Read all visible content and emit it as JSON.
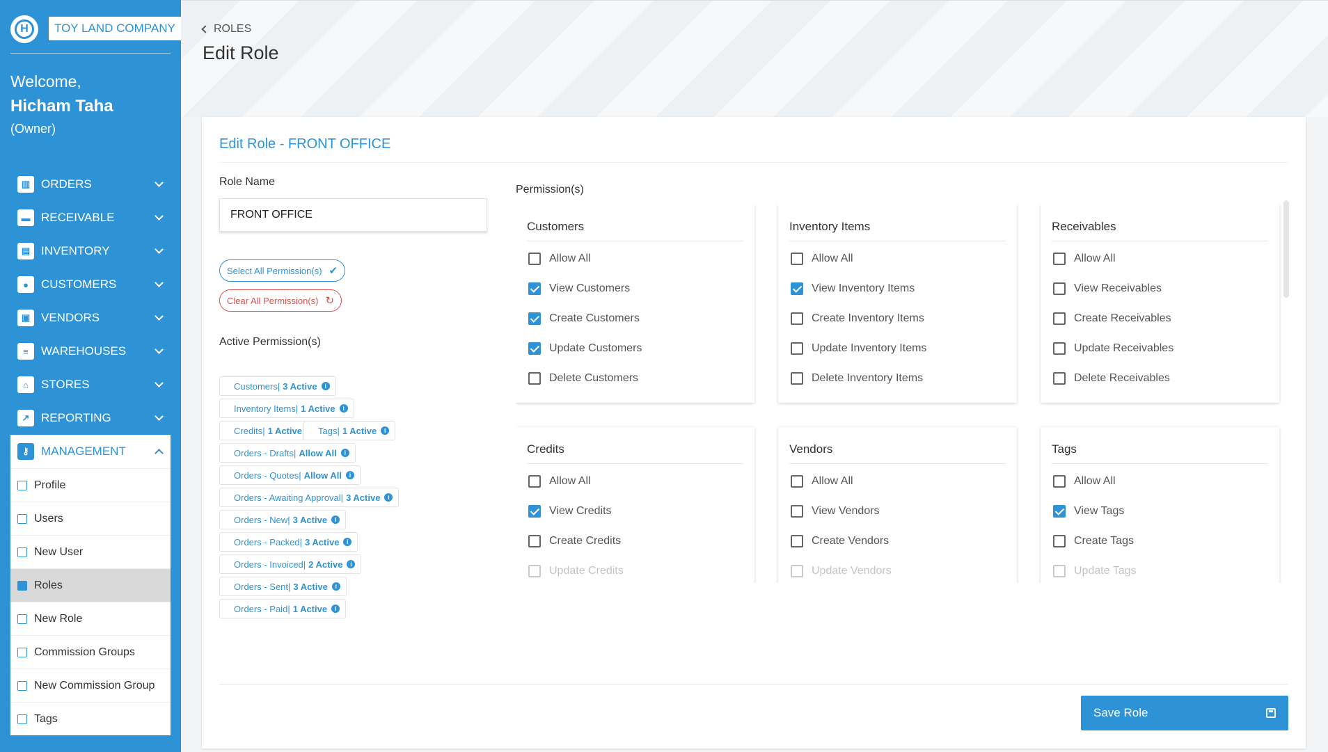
{
  "sidebar": {
    "logo_letter": "H",
    "company": "TOY LAND COMPANY",
    "welcome": "Welcome,",
    "user_name": "Hicham Taha",
    "user_role": "(Owner)",
    "nav": [
      {
        "label": "ORDERS",
        "icon": "bar-chart-icon"
      },
      {
        "label": "RECEIVABLE",
        "icon": "credit-card-icon"
      },
      {
        "label": "INVENTORY",
        "icon": "archive-icon"
      },
      {
        "label": "CUSTOMERS",
        "icon": "users-icon"
      },
      {
        "label": "VENDORS",
        "icon": "address-book-icon"
      },
      {
        "label": "WAREHOUSES",
        "icon": "warehouse-icon"
      },
      {
        "label": "STORES",
        "icon": "store-icon"
      },
      {
        "label": "REPORTING",
        "icon": "chart-line-icon"
      }
    ],
    "management": {
      "label": "MANAGEMENT",
      "icon": "key-icon",
      "items": [
        {
          "label": "Profile",
          "active": false
        },
        {
          "label": "Users",
          "active": false
        },
        {
          "label": "New User",
          "active": false
        },
        {
          "label": "Roles",
          "active": true
        },
        {
          "label": "New Role",
          "active": false
        },
        {
          "label": "Commission Groups",
          "active": false
        },
        {
          "label": "New Commission Group",
          "active": false
        },
        {
          "label": "Tags",
          "active": false
        }
      ]
    }
  },
  "header": {
    "breadcrumb": "ROLES",
    "title": "Edit Role"
  },
  "form": {
    "card_title": "Edit Role - FRONT OFFICE",
    "role_name_label": "Role Name",
    "role_name_value": "FRONT OFFICE",
    "select_all_label": "Select All Permission(s)",
    "clear_all_label": "Clear All Permission(s)",
    "active_label": "Active Permission(s)",
    "active_permissions": [
      {
        "name": "Customers",
        "count": "3 Active"
      },
      {
        "name": "Inventory Items",
        "count": "1 Active"
      },
      {
        "name": "Credits",
        "count": "1 Active"
      },
      {
        "name": "Tags",
        "count": "1 Active"
      },
      {
        "name": "Orders - Drafts",
        "count": "Allow All"
      },
      {
        "name": "Orders - Quotes",
        "count": "Allow All"
      },
      {
        "name": "Orders - Awaiting Approval",
        "count": "3 Active"
      },
      {
        "name": "Orders - New",
        "count": "3 Active"
      },
      {
        "name": "Orders - Packed",
        "count": "3 Active"
      },
      {
        "name": "Orders - Invoiced",
        "count": "2 Active"
      },
      {
        "name": "Orders - Sent",
        "count": "3 Active"
      },
      {
        "name": "Orders - Paid",
        "count": "1 Active"
      }
    ],
    "permissions_label": "Permission(s)",
    "permission_groups": [
      {
        "title": "Customers",
        "items": [
          {
            "label": "Allow All",
            "checked": false
          },
          {
            "label": "View Customers",
            "checked": true
          },
          {
            "label": "Create Customers",
            "checked": true
          },
          {
            "label": "Update Customers",
            "checked": true
          },
          {
            "label": "Delete Customers",
            "checked": false
          }
        ]
      },
      {
        "title": "Inventory Items",
        "items": [
          {
            "label": "Allow All",
            "checked": false
          },
          {
            "label": "View Inventory Items",
            "checked": true
          },
          {
            "label": "Create Inventory Items",
            "checked": false
          },
          {
            "label": "Update Inventory Items",
            "checked": false
          },
          {
            "label": "Delete Inventory Items",
            "checked": false
          }
        ]
      },
      {
        "title": "Receivables",
        "items": [
          {
            "label": "Allow All",
            "checked": false
          },
          {
            "label": "View Receivables",
            "checked": false
          },
          {
            "label": "Create Receivables",
            "checked": false
          },
          {
            "label": "Update Receivables",
            "checked": false
          },
          {
            "label": "Delete Receivables",
            "checked": false
          }
        ]
      },
      {
        "title": "Credits",
        "items": [
          {
            "label": "Allow All",
            "checked": false
          },
          {
            "label": "View Credits",
            "checked": true
          },
          {
            "label": "Create Credits",
            "checked": false
          },
          {
            "label": "Update Credits",
            "checked": false
          }
        ]
      },
      {
        "title": "Vendors",
        "items": [
          {
            "label": "Allow All",
            "checked": false
          },
          {
            "label": "View Vendors",
            "checked": false
          },
          {
            "label": "Create Vendors",
            "checked": false
          },
          {
            "label": "Update Vendors",
            "checked": false
          }
        ]
      },
      {
        "title": "Tags",
        "items": [
          {
            "label": "Allow All",
            "checked": false
          },
          {
            "label": "View Tags",
            "checked": true
          },
          {
            "label": "Create Tags",
            "checked": false
          },
          {
            "label": "Update Tags",
            "checked": false
          }
        ]
      }
    ],
    "save_label": "Save Role"
  },
  "colors": {
    "accent": "#2e93d6",
    "danger": "#d9534f"
  }
}
